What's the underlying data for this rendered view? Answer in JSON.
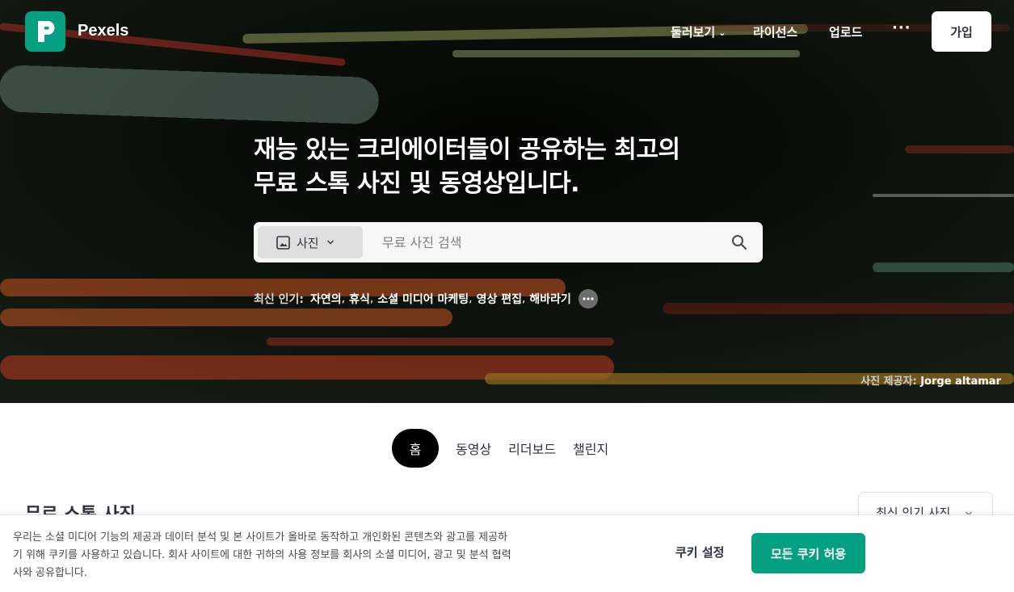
{
  "brand": {
    "name": "Pexels",
    "accent": "#05a081"
  },
  "nav": {
    "explore": "둘러보기",
    "license": "라이선스",
    "upload": "업로드",
    "more": "···",
    "join": "가입"
  },
  "hero": {
    "headline_line1": "재능 있는 크리에이터들이 공유하는 최고의",
    "headline_line2": "무료 스톡 사진 및 동영상입니다.",
    "credit_label": "사진 제공자:",
    "credit_name": "Jorge altamar"
  },
  "search": {
    "type": "사진",
    "placeholder": "무료 사진 검색"
  },
  "trending": {
    "label": "최신 인기:",
    "items": [
      "자연의",
      "휴식",
      "소셜 미디어 마케팅",
      "영상 편집",
      "해바라기"
    ],
    "sep": ","
  },
  "tabs": [
    "홈",
    "동영상",
    "리더보드",
    "챌린지"
  ],
  "section": {
    "title": "무료 스톡 사진",
    "sort": "최신 인기 사진"
  },
  "cookie": {
    "text": "우리는 소셜 미디어 기능의 제공과 데이터 분석 및 본 사이트가 올바로 동작하고 개인화된 콘텐츠와 광고를 제공하기 위해 쿠키를 사용하고 있습니다. 회사 사이트에 대한 귀하의 사용 정보를 회사의 소셜 미디어, 광고 및 분석 협력사와 공유합니다.",
    "settings": "쿠키 설정",
    "accept": "모든 쿠키 허용"
  }
}
